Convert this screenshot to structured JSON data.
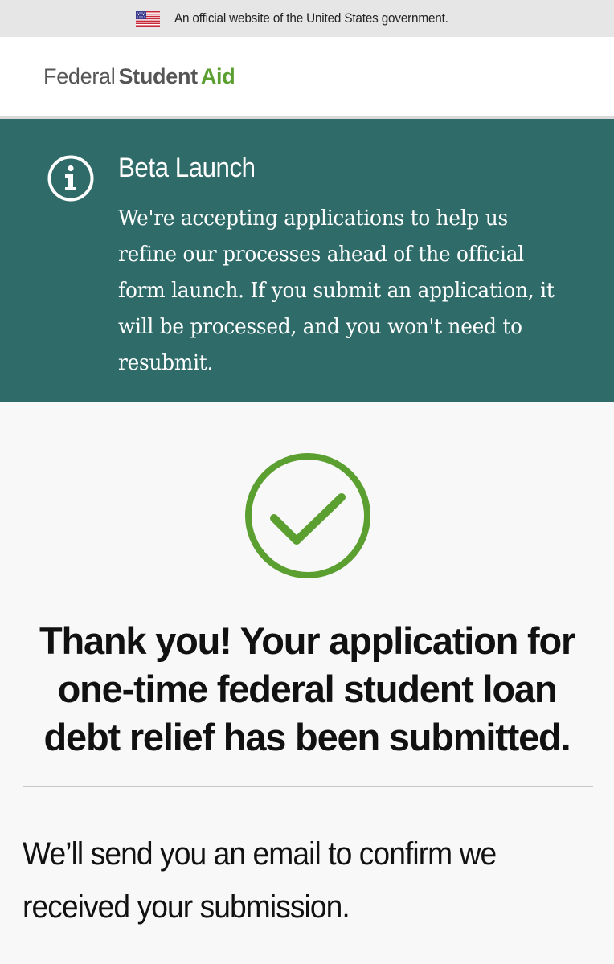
{
  "gov_banner": {
    "text": "An official website of the United States government."
  },
  "header": {
    "logo_federal": "Federal",
    "logo_student": "Student",
    "logo_aid": "Aid"
  },
  "alert": {
    "title": "Beta Launch",
    "body": "We're accepting applications to help us refine our processes ahead of the official form launch. If you submit an application, it will be processed, and you won't need to resubmit."
  },
  "confirmation": {
    "headline": "Thank you! Your application for one-time federal student loan debt relief has been submitted.",
    "message": "We’ll send you an email to confirm we received your submission."
  },
  "colors": {
    "alert_bg": "#2f6c69",
    "accent_green": "#5a9f2f",
    "banner_bg": "#e6e6e6"
  },
  "icons": {
    "flag": "us-flag-icon",
    "info": "info-icon",
    "success": "check-circle-icon"
  }
}
